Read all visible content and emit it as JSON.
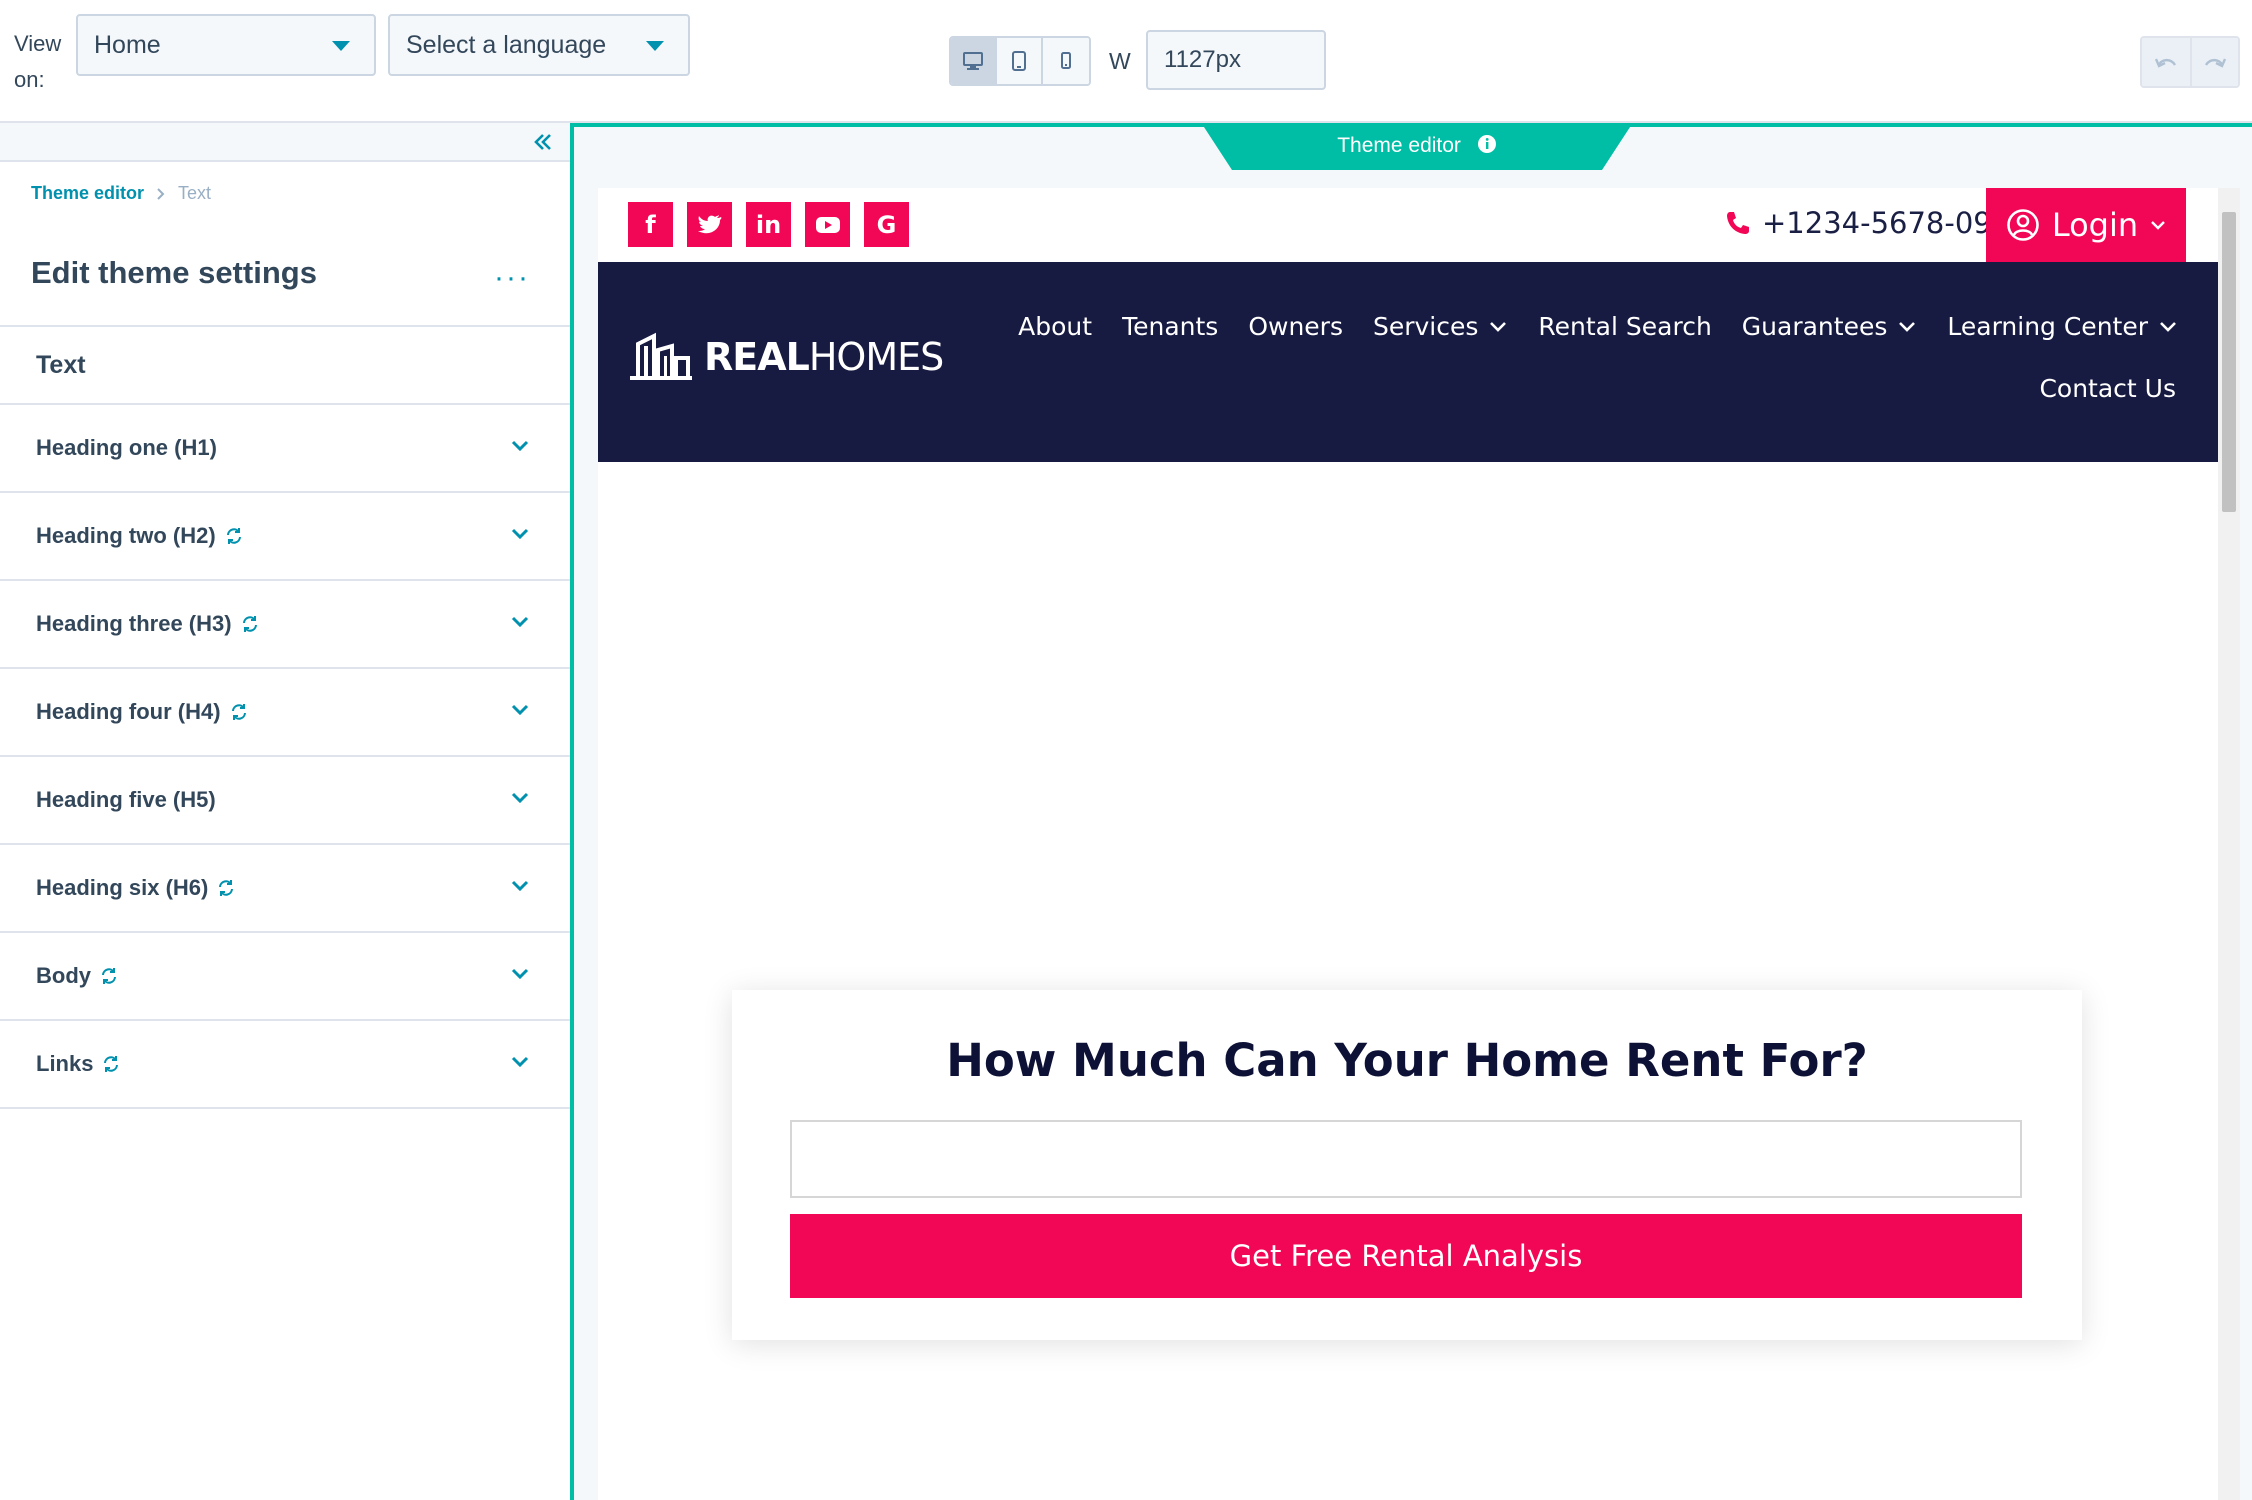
{
  "toolbar": {
    "view_on_label": "View on:",
    "page_select": "Home",
    "language_select": "Select a language",
    "width_label": "W",
    "width_value": "1127px",
    "devices": [
      "desktop-icon",
      "tablet-icon",
      "mobile-icon"
    ],
    "active_device": "desktop"
  },
  "sidebar": {
    "breadcrumb": {
      "root": "Theme editor",
      "current": "Text"
    },
    "title": "Edit theme settings",
    "more": "···",
    "section": "Text",
    "items": [
      {
        "label": "Heading one (H1)",
        "synced": false
      },
      {
        "label": "Heading two (H2)",
        "synced": true
      },
      {
        "label": "Heading three (H3)",
        "synced": true
      },
      {
        "label": "Heading four (H4)",
        "synced": true
      },
      {
        "label": "Heading five (H5)",
        "synced": false
      },
      {
        "label": "Heading six (H6)",
        "synced": true
      },
      {
        "label": "Body",
        "synced": true
      },
      {
        "label": "Links",
        "synced": true
      }
    ]
  },
  "preview": {
    "tab_label": "Theme editor",
    "site": {
      "social": [
        "f",
        "t",
        "in",
        "yt",
        "G"
      ],
      "phone": "+1234-5678-09",
      "login": "Login",
      "logo_bold": "REAL",
      "logo_light": "HOMES",
      "nav": [
        {
          "label": "About",
          "dropdown": false
        },
        {
          "label": "Tenants",
          "dropdown": false
        },
        {
          "label": "Owners",
          "dropdown": false
        },
        {
          "label": "Services",
          "dropdown": true
        },
        {
          "label": "Rental Search",
          "dropdown": false
        },
        {
          "label": "Guarantees",
          "dropdown": true
        },
        {
          "label": "Learning Center",
          "dropdown": true
        }
      ],
      "nav_second_row": "Contact Us",
      "card_title": "How Much Can Your Home Rent For?",
      "card_input_value": "",
      "card_button": "Get Free Rental Analysis"
    }
  },
  "colors": {
    "accent_teal": "#00bda5",
    "link_blue": "#0091ae",
    "brand_pink": "#f20757",
    "navy": "#171a41"
  }
}
